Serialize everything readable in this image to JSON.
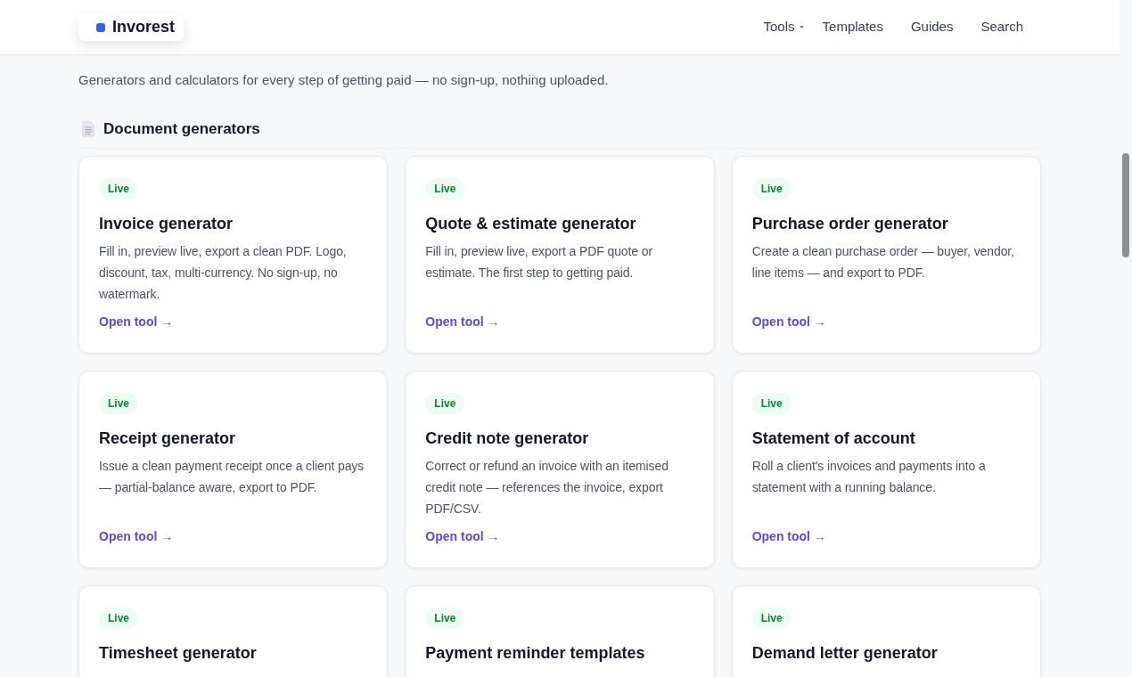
{
  "brand": {
    "name": "Invorest"
  },
  "nav": [
    {
      "label": "Tools",
      "kind": "dropdown"
    },
    {
      "label": "Templates",
      "kind": "link"
    },
    {
      "label": "Guides",
      "kind": "link"
    },
    {
      "label": "Search",
      "kind": "link"
    }
  ],
  "intro": "Generators and calculators for every step of getting paid — no sign-up, nothing uploaded.",
  "section": {
    "title": "Document generators",
    "cards": [
      {
        "badge": "Live",
        "title": "Invoice generator",
        "description": "Fill in, preview live, export a clean PDF. Logo, discount, tax, multi-currency. No sign-up, no watermark.",
        "link": "Open tool →"
      },
      {
        "badge": "Live",
        "title": "Quote & estimate generator",
        "description": "Fill in, preview live, export a PDF quote or estimate. The first step to getting paid.",
        "link": "Open tool →"
      },
      {
        "badge": "Live",
        "title": "Purchase order generator",
        "description": "Create a clean purchase order — buyer, vendor, line items — and export to PDF.",
        "link": "Open tool →"
      },
      {
        "badge": "Live",
        "title": "Receipt generator",
        "description": "Issue a clean payment receipt once a client pays — partial-balance aware, export to PDF.",
        "link": "Open tool →"
      },
      {
        "badge": "Live",
        "title": "Credit note generator",
        "description": "Correct or refund an invoice with an itemised credit note — references the invoice, export PDF/CSV.",
        "link": "Open tool →"
      },
      {
        "badge": "Live",
        "title": "Statement of account",
        "description": "Roll a client's invoices and payments into a statement with a running balance.",
        "link": "Open tool →"
      },
      {
        "badge": "Live",
        "title": "Timesheet generator"
      },
      {
        "badge": "Live",
        "title": "Payment reminder templates"
      },
      {
        "badge": "Live",
        "title": "Demand letter generator"
      }
    ]
  }
}
